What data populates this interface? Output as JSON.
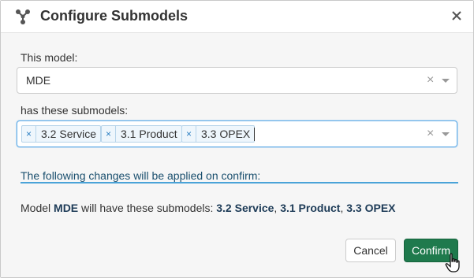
{
  "dialog": {
    "title": "Configure Submodels",
    "header_icon": "submodels-network-icon",
    "close_icon": "close-icon"
  },
  "model_field": {
    "label": "This model:",
    "value": "MDE"
  },
  "submodels_field": {
    "label": "has these submodels:",
    "tags": [
      {
        "label": "3.2 Service"
      },
      {
        "label": "3.1 Product"
      },
      {
        "label": "3.3 OPEX"
      }
    ]
  },
  "changes": {
    "title": "The following changes will be applied on confirm:",
    "summary_prefix": "Model ",
    "summary_model": "MDE",
    "summary_middle": " will have these submodels: ",
    "summary_items": [
      "3.2 Service",
      "3.1 Product",
      "3.3 OPEX"
    ],
    "summary_separator": ", "
  },
  "buttons": {
    "cancel_label": "Cancel",
    "confirm_label": "Confirm"
  },
  "colors": {
    "confirm_bg": "#1f7a4d",
    "focus_border": "#66afe9",
    "tag_bg": "#eef6fc"
  }
}
